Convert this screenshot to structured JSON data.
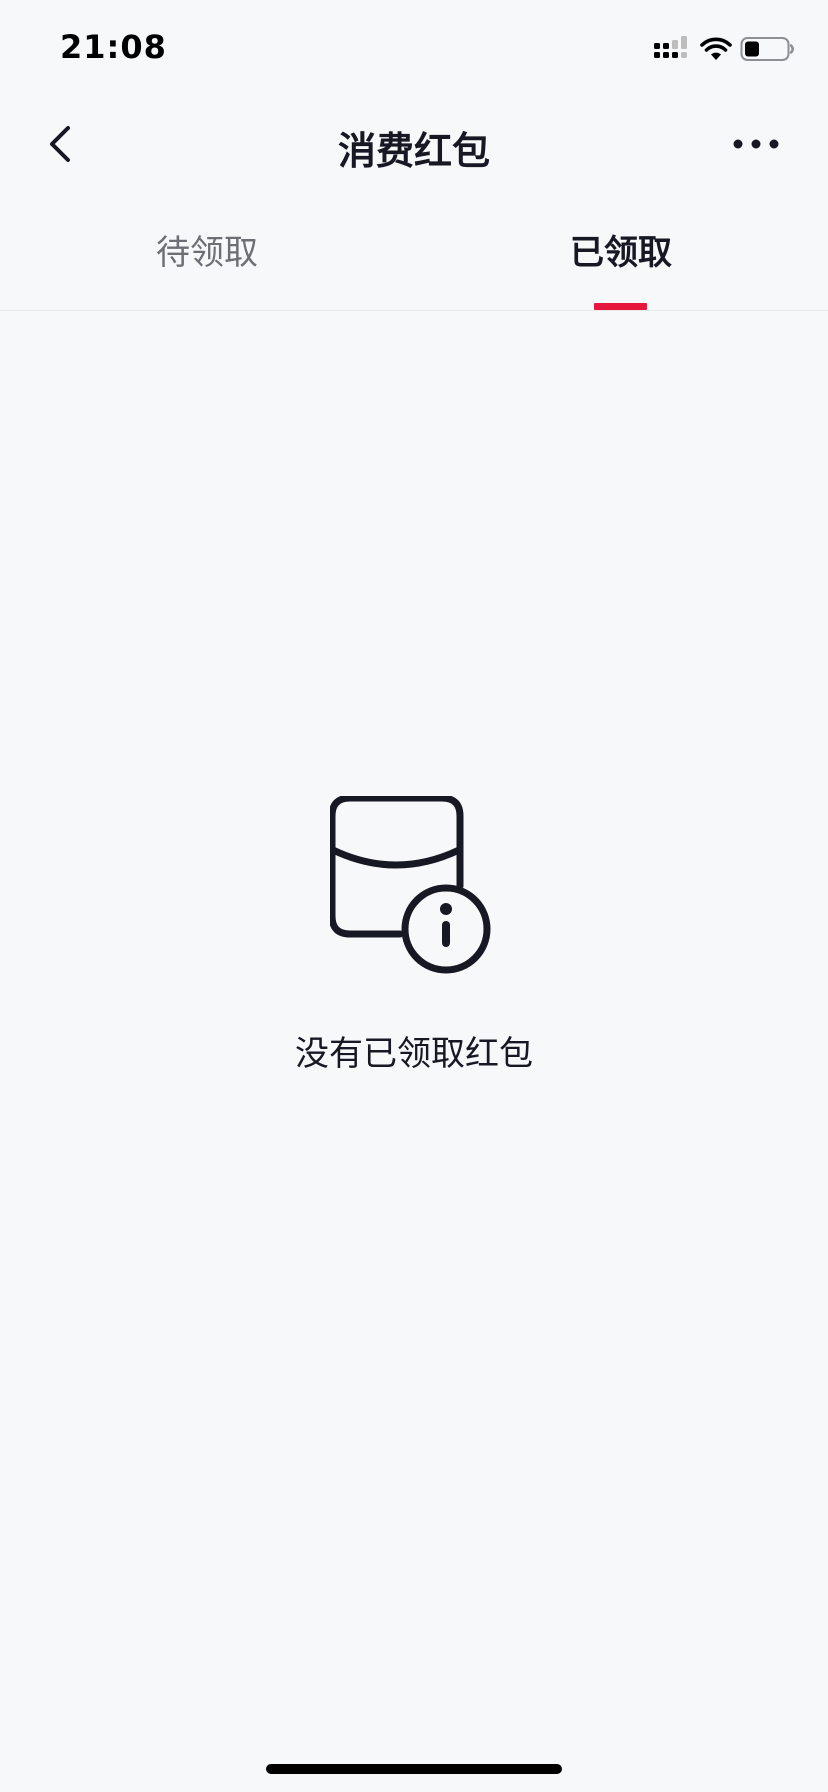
{
  "status_bar": {
    "time": "21:08",
    "signal_icon": "cellular-signal-icon",
    "wifi_icon": "wifi-icon",
    "battery_icon": "battery-icon",
    "battery_level": 0.35
  },
  "nav": {
    "back_icon": "chevron-left-icon",
    "title": "消费红包",
    "more_icon": "more-dots-icon"
  },
  "tabs": [
    {
      "label": "待领取",
      "active": false
    },
    {
      "label": "已领取",
      "active": true
    }
  ],
  "empty_state": {
    "icon": "red-packet-info-icon",
    "message": "没有已领取红包"
  },
  "colors": {
    "accent": "#e5173d",
    "background": "#f7f8fa",
    "text_primary": "#161823",
    "text_secondary": "#6e6f75"
  }
}
